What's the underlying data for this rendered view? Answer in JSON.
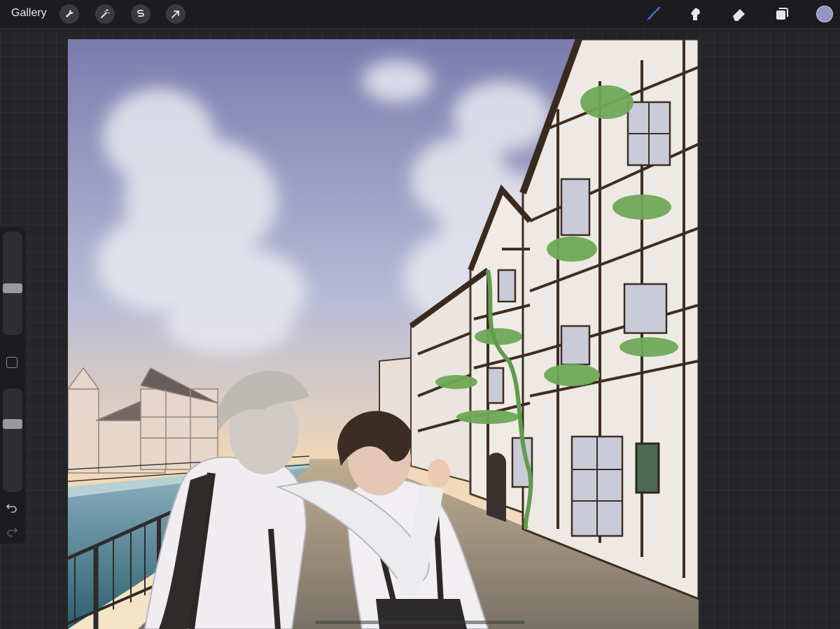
{
  "topbar": {
    "gallery_label": "Gallery",
    "left_tools": [
      "wrench-icon",
      "magic-wand-icon",
      "selection-icon",
      "transform-arrow-icon"
    ],
    "right_tools": [
      "brush-icon",
      "smudge-icon",
      "eraser-icon",
      "layers-icon"
    ],
    "active_tool": "brush-icon",
    "current_color": "#9495c4",
    "accent_color": "#3b7be8"
  },
  "sidebar": {
    "brush_size": 0.55,
    "opacity": 0.33,
    "controls": [
      "brush-size-slider",
      "modify-button",
      "opacity-slider",
      "undo-icon",
      "redo-icon"
    ]
  },
  "canvas": {
    "content": "painting",
    "sky_color": "#7f82b0",
    "horizon_color": "#f2c99a"
  }
}
